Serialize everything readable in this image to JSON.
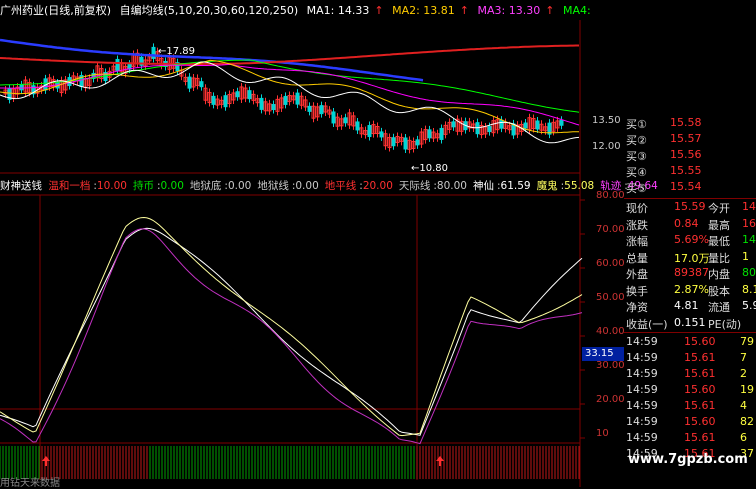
{
  "colors": {
    "up": "#ff3232",
    "down": "#00d4d4",
    "ma1": "#ffffff",
    "ma2": "#ffcc00",
    "ma3": "#ff00ff",
    "ma4": "#00ff00",
    "blue": "#2a3cff",
    "red": "#e02020",
    "grid": "#800000"
  },
  "header": {
    "stock": "广州药业(日线,前复权)",
    "ma_name": "自编均线(5,10,20,30,60,120,250)",
    "ma1_label": "MA1: 14.33",
    "ma2_label": "MA2: 13.81",
    "ma3_label": "MA3: 13.30",
    "ma4_label": "MA4:"
  },
  "price_annotations": {
    "high": "17.89",
    "low": "10.80"
  },
  "price_axis": [
    "13.50",
    "12.00"
  ],
  "indicator": {
    "name": "财神送钱",
    "items": [
      {
        "label": "温和一档",
        "value": "10.00",
        "color": "#ff3030"
      },
      {
        "label": "持币",
        "value": "0.00",
        "color": "#00e000"
      },
      {
        "label": "地狱底",
        "value": "0.00",
        "color": "#c8c8c8"
      },
      {
        "label": "地狱线",
        "value": "0.00",
        "color": "#c8c8c8"
      },
      {
        "label": "地平线",
        "value": "20.00",
        "color": "#ff3030"
      },
      {
        "label": "天际线",
        "value": "80.00",
        "color": "#c8c8c8"
      },
      {
        "label": "神仙",
        "value": "61.59",
        "color": "#ffffff"
      },
      {
        "label": "魔鬼",
        "value": "55.08",
        "color": "#ffff60"
      },
      {
        "label": "轨迹",
        "value": "49.64",
        "color": "#ff40ff"
      }
    ]
  },
  "ind_axis": [
    "80.00",
    "70.00",
    "60.00",
    "50.00",
    "40.00",
    "30.00",
    "20.00",
    "10"
  ],
  "cursor_value": "33.15",
  "quote": {
    "bids": [
      {
        "label": "买①",
        "price": "15.58"
      },
      {
        "label": "买②",
        "price": "15.57"
      },
      {
        "label": "买③",
        "price": "15.56"
      },
      {
        "label": "买④",
        "price": "15.55"
      },
      {
        "label": "买⑤",
        "price": "15.54"
      }
    ],
    "stats": [
      {
        "l1": "现价",
        "v1": "15.59",
        "l2": "今开",
        "v2": "14",
        "c1": "#ff3030",
        "c2": "#ff3030"
      },
      {
        "l1": "涨跌",
        "v1": "0.84",
        "l2": "最高",
        "v2": "16",
        "c1": "#ff3030",
        "c2": "#ff3030"
      },
      {
        "l1": "涨幅",
        "v1": "5.69%",
        "l2": "最低",
        "v2": "14",
        "c1": "#ff3030",
        "c2": "#00e000"
      },
      {
        "l1": "总量",
        "v1": "17.0万",
        "l2": "量比",
        "v2": "1",
        "c1": "#ffff40",
        "c2": "#ffff40"
      },
      {
        "l1": "外盘",
        "v1": "89387",
        "l2": "内盘",
        "v2": "80",
        "c1": "#ff3030",
        "c2": "#00e000"
      },
      {
        "l1": "换手",
        "v1": "2.87%",
        "l2": "股本",
        "v2": "8.1",
        "c1": "#ffff40",
        "c2": "#ffff40"
      },
      {
        "l1": "净资",
        "v1": "4.81",
        "l2": "流通",
        "v2": "5.9",
        "c1": "#ffffff",
        "c2": "#ffffff"
      },
      {
        "l1": "收益(一)",
        "v1": "0.151",
        "l2": "PE(动)",
        "v2": "",
        "c1": "#ffffff",
        "c2": "#ffffff"
      }
    ],
    "ticks": [
      {
        "time": "14:59",
        "price": "15.60",
        "vol": "79"
      },
      {
        "time": "14:59",
        "price": "15.61",
        "vol": "7"
      },
      {
        "time": "14:59",
        "price": "15.61",
        "vol": "2"
      },
      {
        "time": "14:59",
        "price": "15.60",
        "vol": "19"
      },
      {
        "time": "14:59",
        "price": "15.61",
        "vol": "4"
      },
      {
        "time": "14:59",
        "price": "15.60",
        "vol": "82"
      },
      {
        "time": "14:59",
        "price": "15.61",
        "vol": "6"
      },
      {
        "time": "14:59",
        "price": "15.61",
        "vol": "37"
      }
    ]
  },
  "watermark": "www.7gpzb.com",
  "footer": "用钻天来数据"
}
